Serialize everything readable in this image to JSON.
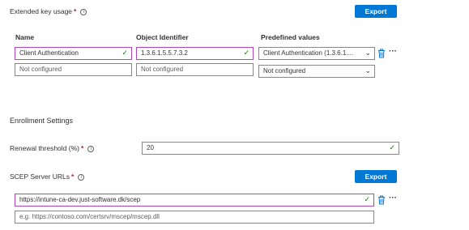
{
  "eku": {
    "label": "Extended key usage",
    "required": "*",
    "export_label": "Export",
    "col_name": "Name",
    "col_oid": "Object Identifier",
    "col_predef": "Predefined values",
    "row1": {
      "name": "Client Authentication",
      "oid": "1.3.6.1.5.5.7.3.2",
      "predef": "Client Authentication (1.3.6.1...."
    },
    "row2": {
      "name": "Not configured",
      "oid": "Not configured",
      "predef": "Not configured"
    }
  },
  "enrollment": {
    "title": "Enrollment Settings",
    "renewal_label": "Renewal threshold (%)",
    "required": "*",
    "renewal_value": "20"
  },
  "scep": {
    "label": "SCEP Server URLs",
    "required": "*",
    "export_label": "Export",
    "url_value": "https://intune-ca-dev.just-software.dk/scep",
    "url_placeholder": "e.g. https://contoso.com/certsrv/mscep/mscep.dll"
  },
  "icons": {
    "info": "info-icon",
    "check": "checkmark-icon",
    "chevron": "chevron-down-icon",
    "trash": "trash-icon",
    "more": "more-icon"
  },
  "colors": {
    "accent": "#0078d4",
    "valid": "#107c10",
    "selected_border": "#b146c2",
    "required": "#a4262c"
  }
}
